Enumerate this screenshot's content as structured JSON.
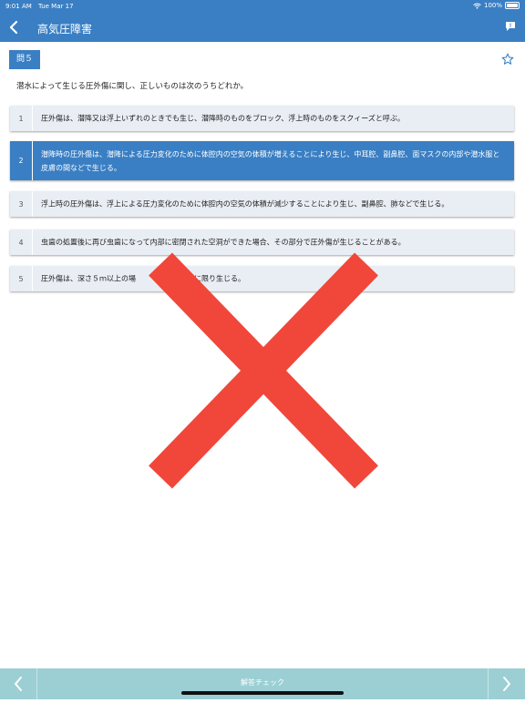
{
  "status": {
    "time": "9:01 AM",
    "date": "Tue Mar 17",
    "battery": "100%"
  },
  "nav": {
    "title": "高気圧障害"
  },
  "question": {
    "badge": "問５",
    "text": "潜水によって生じる圧外傷に関し、正しいものは次のうちどれか。"
  },
  "options": [
    {
      "num": "1",
      "text": "圧外傷は、潜降又は浮上いずれのときでも生じ、潜降時のものをブロック、浮上時のものをスクィーズと呼ぶ。"
    },
    {
      "num": "2",
      "text": "潜降時の圧外傷は、潜降による圧力変化のために体腔内の空気の体積が増えることにより生じ、中耳腔、副鼻腔、面マスクの内部や潜水服と皮膚の間などで生じる。"
    },
    {
      "num": "3",
      "text": "浮上時の圧外傷は、浮上による圧力変化のために体腔内の空気の体積が減少することにより生じ、副鼻腔、肺などで生じる。"
    },
    {
      "num": "4",
      "text": "虫歯の処置後に再び虫歯になって内部に密閉された空洞ができた場合、その部分で圧外傷が生じることがある。"
    },
    {
      "num": "5",
      "text": "圧外傷は、深さ５ｍ以上の場　　　　　の場合に限り生じる。"
    }
  ],
  "selected_option": "2",
  "result_mark": "incorrect",
  "bottom": {
    "label": "解答チェック"
  },
  "colors": {
    "accent": "#3a7fc4",
    "option_bg": "#e9eef4",
    "cross": "#f0473a",
    "bottom_bar": "#9bcfd4"
  },
  "icons": {
    "back": "chevron-left-icon",
    "chat": "chat-bubble-icon",
    "star": "star-outline-icon",
    "prev": "chevron-left-icon",
    "next": "chevron-right-icon",
    "result": "cross-mark-icon"
  }
}
